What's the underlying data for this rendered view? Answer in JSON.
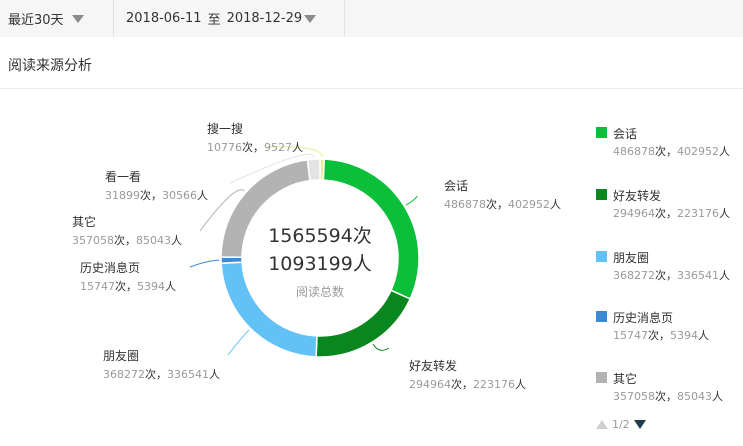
{
  "filters": {
    "range_label": "最近30天",
    "date_start": "2018-06-11",
    "date_sep": "至",
    "date_end": "2018-12-29"
  },
  "section_title": "阅读来源分析",
  "center": {
    "total_count": "1565594次",
    "total_people": "1093199人",
    "label": "阅读总数"
  },
  "chart_data": {
    "type": "pie",
    "unit_count": "次",
    "unit_people": "人",
    "separator": "，",
    "series": [
      {
        "name": "搜一搜",
        "count": 10776,
        "people": 9527,
        "color": "#e9ef8f"
      },
      {
        "name": "会话",
        "count": 486878,
        "people": 402952,
        "color": "#0cbf3a"
      },
      {
        "name": "好友转发",
        "count": 294964,
        "people": 223176,
        "color": "#0a861f"
      },
      {
        "name": "朋友圈",
        "count": 368272,
        "people": 336541,
        "color": "#62c2f5"
      },
      {
        "name": "历史消息页",
        "count": 15747,
        "people": 5394,
        "color": "#3a8ad6"
      },
      {
        "name": "其它",
        "count": 357058,
        "people": 85043,
        "color": "#b3b3b3"
      },
      {
        "name": "看一看",
        "count": 31899,
        "people": 30566,
        "color": "#e3e3e3"
      }
    ]
  },
  "legend": {
    "items": [
      {
        "name": "会话",
        "count": "486878",
        "people": "402952",
        "color": "#0cbf3a"
      },
      {
        "name": "好友转发",
        "count": "294964",
        "people": "223176",
        "color": "#0a861f"
      },
      {
        "name": "朋友圈",
        "count": "368272",
        "people": "336541",
        "color": "#62c2f5"
      },
      {
        "name": "历史消息页",
        "count": "15747",
        "people": "5394",
        "color": "#3a8ad6"
      },
      {
        "name": "其它",
        "count": "357058",
        "people": "85043",
        "color": "#b3b3b3"
      }
    ],
    "page": "1/2"
  }
}
